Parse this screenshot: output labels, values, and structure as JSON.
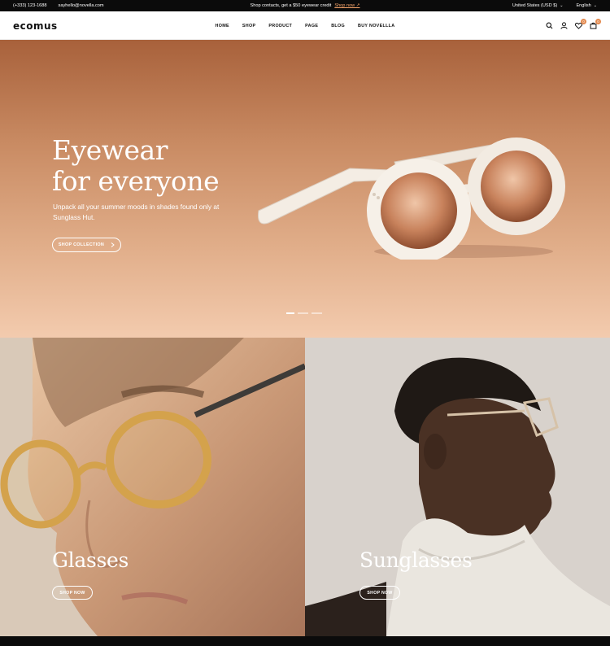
{
  "topbar": {
    "phone": "(+333) 123-1688",
    "email": "sayhello@novella.com",
    "promo_text": "Shop contacts, get a $50 eyewear credit",
    "promo_link": "Shop now ↗",
    "currency": "United States (USD $)",
    "language": "English"
  },
  "header": {
    "logo": "ecomus",
    "nav": [
      "HOME",
      "SHOP",
      "PRODUCT",
      "PAGE",
      "BLOG",
      "BUY NOVELLLA"
    ],
    "wishlist_count": "0",
    "cart_count": "0"
  },
  "hero": {
    "title_line1": "Eyewear",
    "title_line2": "for everyone",
    "subtitle": "Unpack all your summer moods in shades found only at Sunglass Hut.",
    "button_label": "SHOP COLLECTION",
    "slides_total": 3,
    "slide_active": 1
  },
  "categories": [
    {
      "title": "Glasses",
      "button_label": "SHOP NOW"
    },
    {
      "title": "Sunglasses",
      "button_label": "SHOP NOW"
    }
  ],
  "colors": {
    "accent": "#e38a4f",
    "hero_top": "#a8613b",
    "hero_bottom": "#f3cbae",
    "topbar_bg": "#0b0b0b"
  },
  "icons": [
    "search-icon",
    "user-icon",
    "heart-icon",
    "cart-icon",
    "chevron-right-icon",
    "chevron-down-icon"
  ]
}
